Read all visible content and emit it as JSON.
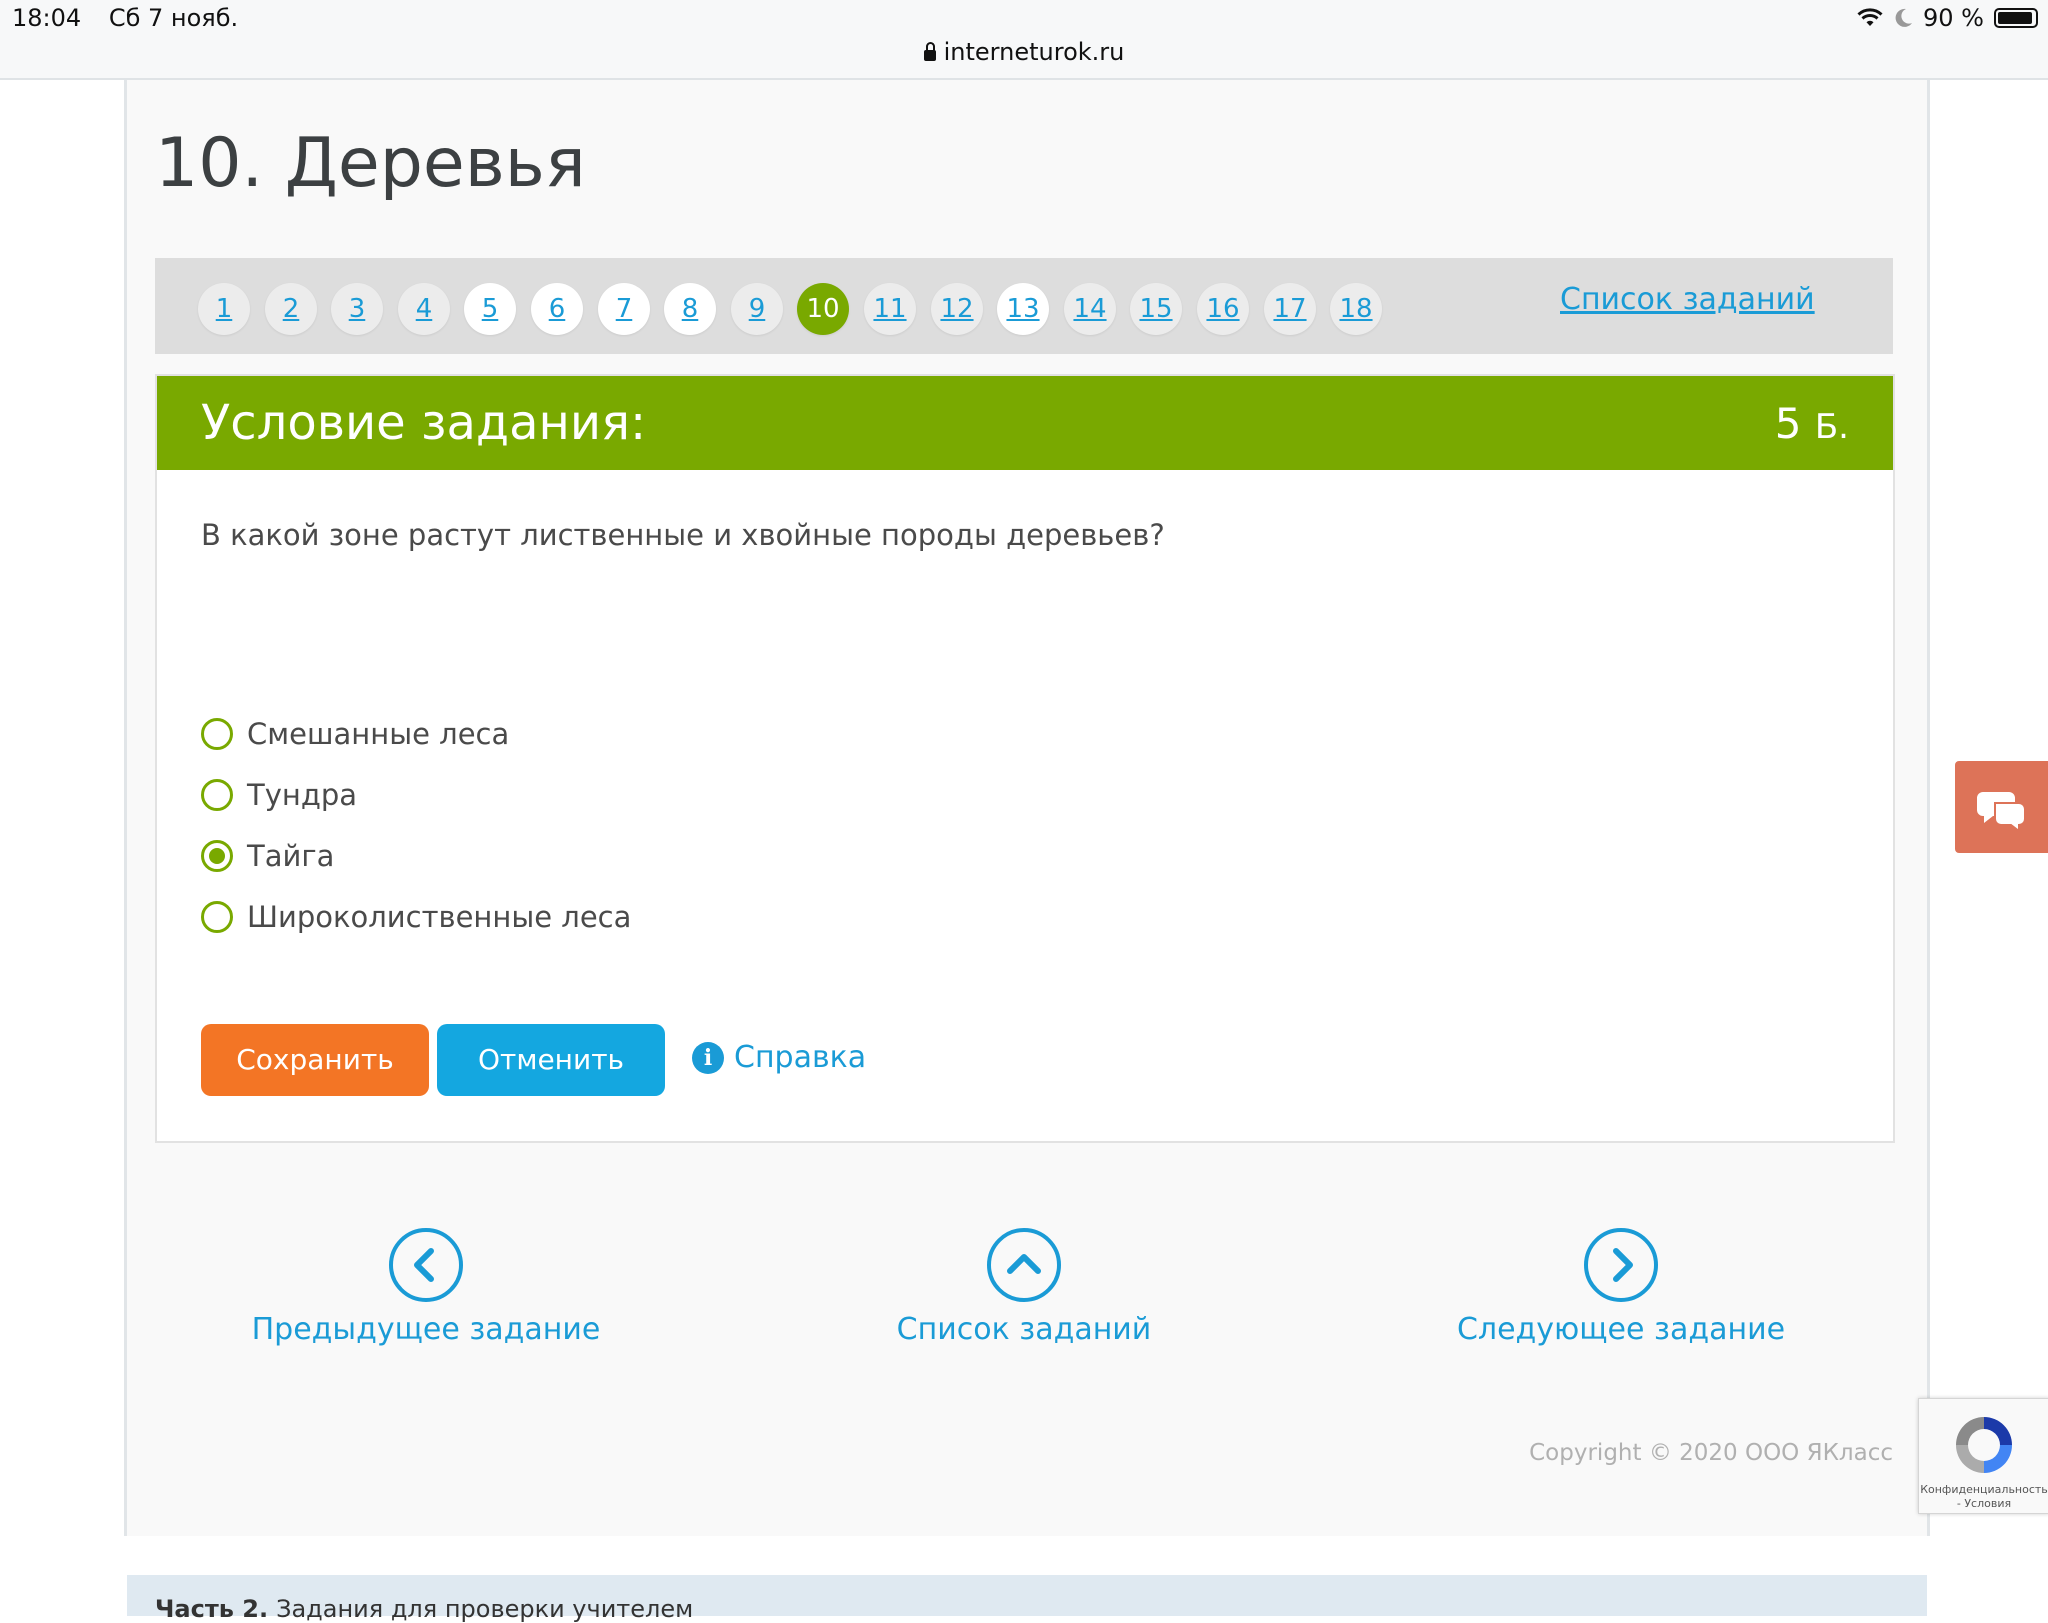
{
  "status_bar": {
    "time": "18:04",
    "date": "Сб 7 нояб.",
    "battery": "90 %",
    "battery_level": 0.9,
    "url": "interneturok.ru"
  },
  "page": {
    "title": "10. Деревья"
  },
  "pager": {
    "items": [
      "1",
      "2",
      "3",
      "4",
      "5",
      "6",
      "7",
      "8",
      "9",
      "10",
      "11",
      "12",
      "13",
      "14",
      "15",
      "16",
      "17",
      "18"
    ],
    "active": "10",
    "white_items": [
      "5",
      "6",
      "7",
      "8",
      "13"
    ],
    "list_link": "Список заданий"
  },
  "task": {
    "header": "Условие задания:",
    "points": "5",
    "points_unit": "Б.",
    "question": "В какой зоне растут лиственные и хвойные породы деревьев?",
    "options": [
      {
        "label": "Смешанные леса",
        "checked": false
      },
      {
        "label": "Тундра",
        "checked": false
      },
      {
        "label": "Тайга",
        "checked": true
      },
      {
        "label": "Широколиственные леса",
        "checked": false
      }
    ],
    "save_label": "Сохранить",
    "cancel_label": "Отменить",
    "help_label": "Справка"
  },
  "nav": {
    "prev_label": "Предыдущее задание",
    "list_label": "Список заданий",
    "next_label": "Следующее задание"
  },
  "footer": {
    "copyright": "Copyright © 2020 ООО ЯКласс",
    "part_title": "Часть 2.",
    "part_text": "Задания для проверки учителем"
  },
  "captcha": {
    "text": "Конфиденциальность - Условия"
  },
  "colors": {
    "accent_green": "#79a900",
    "link_blue": "#1a9bd6",
    "save_orange": "#f37525",
    "cancel_blue": "#14a7e0",
    "chat_widget": "#dd7358"
  },
  "icons": {
    "lock": "lock-icon",
    "wifi": "wifi-icon",
    "moon": "moon-icon",
    "battery": "battery-icon",
    "info": "info-icon",
    "chevron_left": "chevron-left-icon",
    "chevron_up": "chevron-up-icon",
    "chevron_right": "chevron-right-icon",
    "chat": "chat-icon",
    "recaptcha": "recaptcha-icon"
  }
}
